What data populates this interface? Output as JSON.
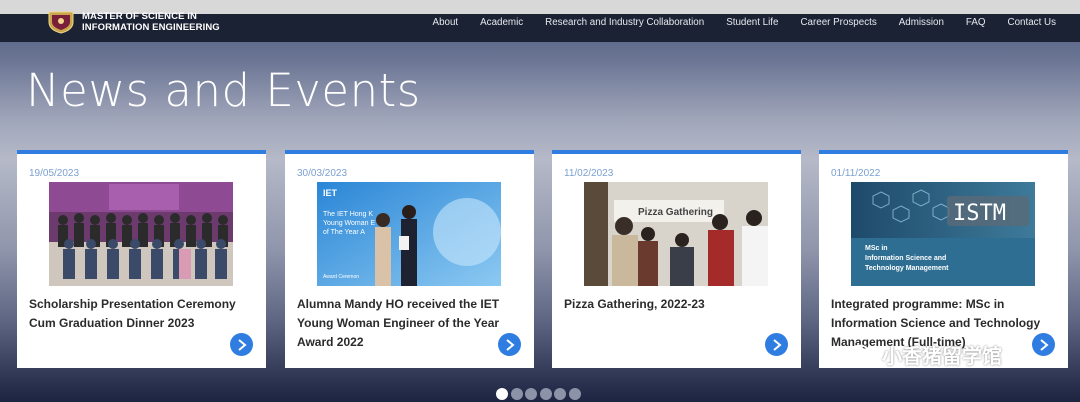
{
  "header": {
    "logo_line1": "MASTER OF SCIENCE IN",
    "logo_line2": "INFORMATION ENGINEERING",
    "nav": [
      "About",
      "Academic",
      "Research and Industry Collaboration",
      "Student Life",
      "Career Prospects",
      "Admission",
      "FAQ",
      "Contact Us"
    ]
  },
  "hero": {
    "title": "News and Events"
  },
  "cards": [
    {
      "date": "19/05/2023",
      "title": "Scholarship Presentation Ceremony Cum Graduation Dinner 2023"
    },
    {
      "date": "30/03/2023",
      "title": "Alumna Mandy HO received the IET Young Woman Engineer of the Year Award 2022"
    },
    {
      "date": "11/02/2023",
      "title": "Pizza Gathering, 2022-23"
    },
    {
      "date": "01/11/2022",
      "title": "Integrated programme: MSc in Information Science and Technology Management (Full-time)"
    }
  ],
  "card_images": {
    "card2_line1": "The IET Hong K",
    "card2_line2": "Young Woman E",
    "card2_line3": "of The Year A",
    "card2_award": "Award Ceremon",
    "card3_text": "Pizza Gathering",
    "card4_badge": "ISTM",
    "card4_line1": "MSc in",
    "card4_line2": "Information Science and",
    "card4_line3": "Technology Management"
  },
  "carousel": {
    "dot_count": 6,
    "active_index": 0
  },
  "watermark": {
    "text": "小香猪留学馆"
  },
  "colors": {
    "accent": "#2f7de1",
    "navbar": "#1b2233"
  }
}
